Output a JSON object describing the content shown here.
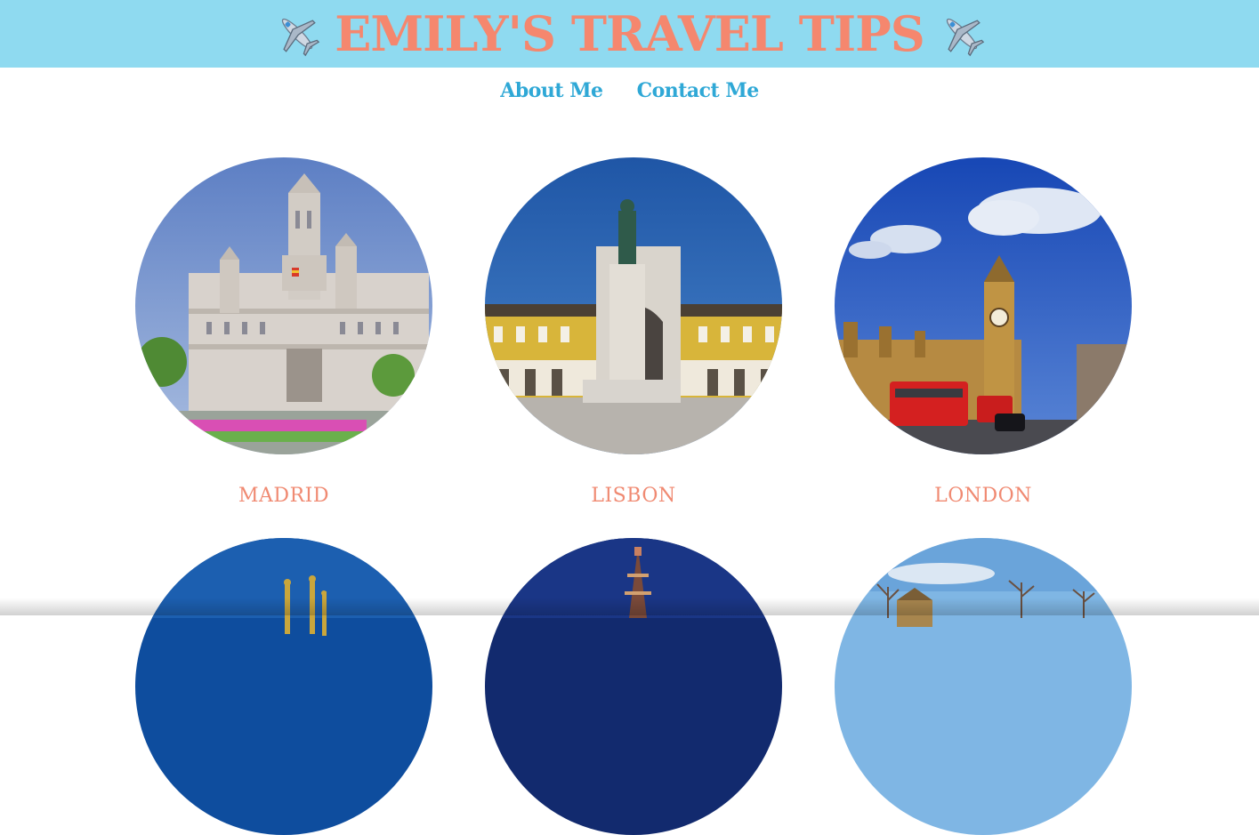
{
  "header": {
    "title": "EMILY'S TRAVEL TIPS",
    "background": "#8fdaf0",
    "title_color": "#f5876e",
    "left_icon": "airplane-icon",
    "right_icon": "airplane-icon"
  },
  "nav": {
    "items": [
      {
        "label": "About Me"
      },
      {
        "label": "Contact Me"
      }
    ],
    "color": "#2fa8d6"
  },
  "destinations": [
    {
      "name": "MADRID",
      "icon": "madrid-photo"
    },
    {
      "name": "LISBON",
      "icon": "lisbon-photo"
    },
    {
      "name": "LONDON",
      "icon": "london-photo"
    },
    {
      "name": "",
      "icon": "barcelona-photo"
    },
    {
      "name": "",
      "icon": "paris-photo"
    },
    {
      "name": "",
      "icon": "countryside-photo"
    }
  ],
  "label_color": "#f08a72"
}
